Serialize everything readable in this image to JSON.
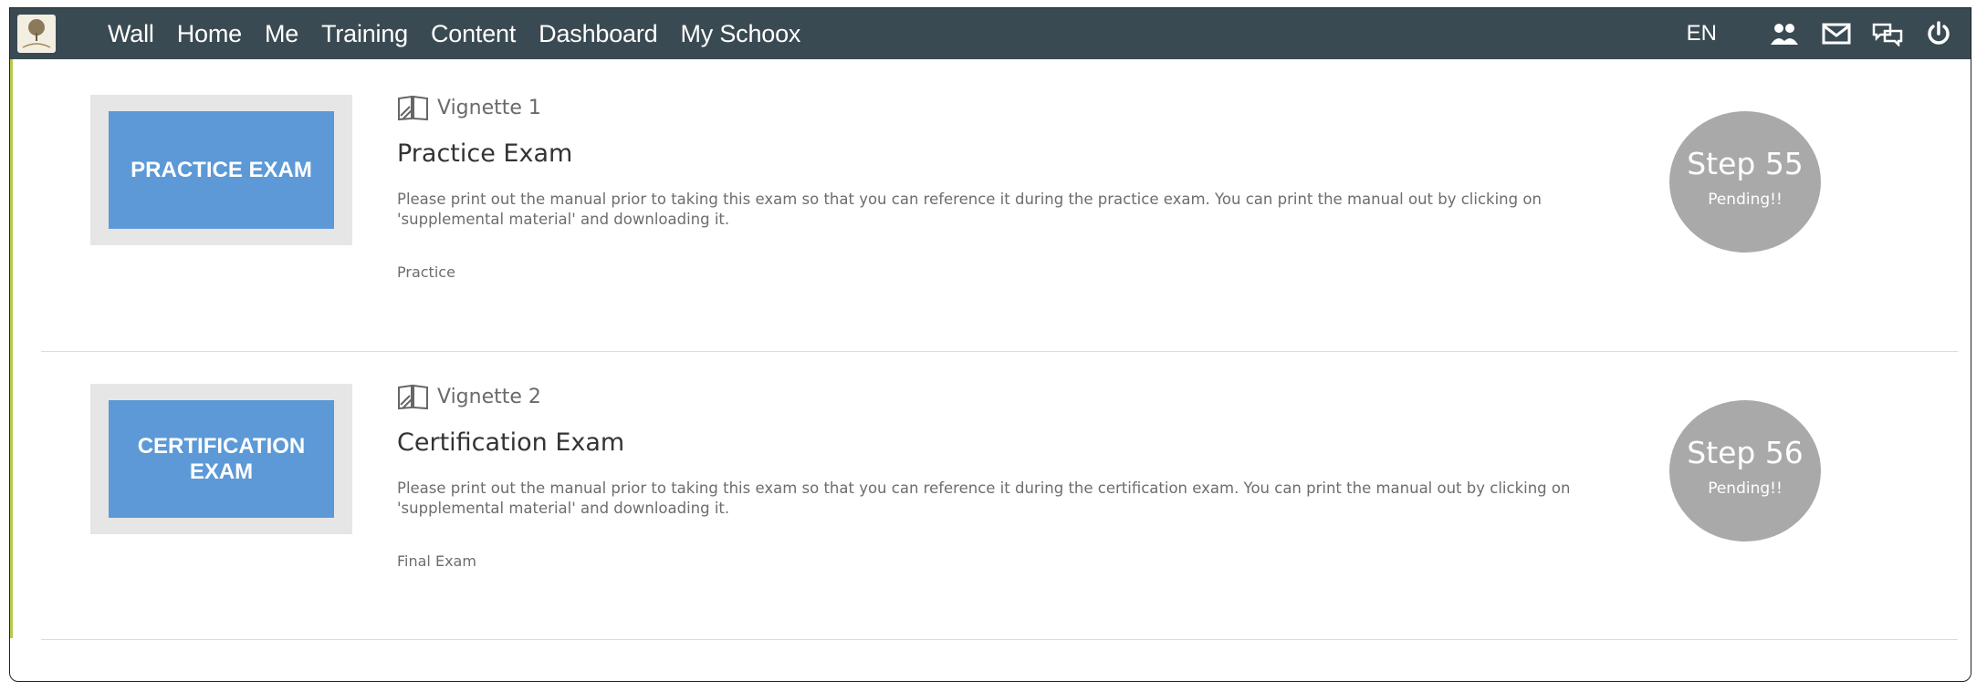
{
  "nav": {
    "items": [
      "Wall",
      "Home",
      "Me",
      "Training",
      "Content",
      "Dashboard",
      "My Schoox"
    ],
    "language": "EN",
    "icons": [
      "users-icon",
      "mail-icon",
      "chat-icon",
      "power-icon"
    ]
  },
  "courses": [
    {
      "thumbnail_text": "PRACTICE EXAM",
      "vignette": "Vignette 1",
      "title": "Practice Exam",
      "description": "Please print out the manual prior to taking this exam so that you can reference it during the practice exam. You can print the manual out by clicking on 'supplemental material' and downloading it.",
      "tag": "Practice",
      "step": "Step 55",
      "status": "Pending!!"
    },
    {
      "thumbnail_text": "CERTIFICATION EXAM",
      "vignette": "Vignette 2",
      "title": "Certification Exam",
      "description": "Please print out the manual prior to taking this exam so that you can reference it during the certification exam. You can print the manual out by clicking on 'supplemental material' and downloading it.",
      "tag": "Final Exam",
      "step": "Step 56",
      "status": "Pending!!"
    }
  ],
  "colors": {
    "navbar": "#3a4a52",
    "thumbnail": "#5c99d6",
    "step_circle": "#a9a9a9",
    "accent": "#b7c94a"
  }
}
